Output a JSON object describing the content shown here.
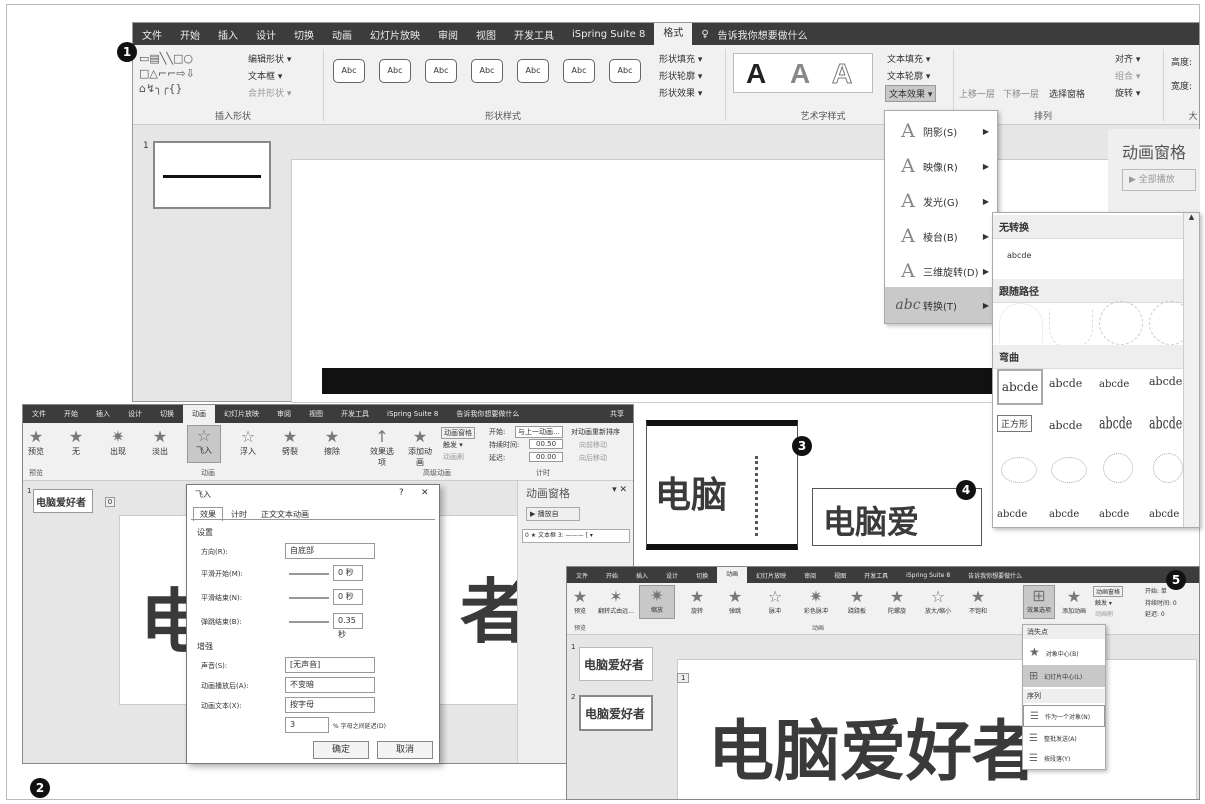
{
  "callouts": [
    "1",
    "2",
    "3",
    "4",
    "5"
  ],
  "win1": {
    "tabs": [
      "文件",
      "开始",
      "插入",
      "设计",
      "切换",
      "动画",
      "幻灯片放映",
      "审阅",
      "视图",
      "开发工具",
      "iSpring Suite 8",
      "格式"
    ],
    "active_tab": "格式",
    "tell_me": "告诉我你想要做什么",
    "insert_shapes_label": "插入形状",
    "edit_shape": "编辑形状 ▾",
    "text_box": "文本框 ▾",
    "merge_shapes": "合并形状 ▾",
    "shape_styles_label": "形状样式",
    "abc_label": "Abc",
    "shape_fill": "形状填充 ▾",
    "shape_outline": "形状轮廓 ▾",
    "shape_effects": "形状效果 ▾",
    "wordart_label": "艺术字样式",
    "wordart_letter": "A",
    "text_fill": "文本填充 ▾",
    "text_outline": "文本轮廓 ▾",
    "text_effects": "文本效果 ▾",
    "arrange_label": "排列",
    "bring_forward": "上移一层",
    "send_backward": "下移一层",
    "selection_pane": "选择窗格",
    "align": "对齐 ▾",
    "group": "组合 ▾",
    "rotate": "旋转 ▾",
    "height": "高度:",
    "width": "宽度:",
    "size_label": "大",
    "slide_num": "1",
    "anim_pane_title": "动画窗格",
    "play_all": "全部播放"
  },
  "effects_menu": [
    {
      "icon": "A",
      "label": "阴影(S)"
    },
    {
      "icon": "A",
      "label": "映像(R)"
    },
    {
      "icon": "A",
      "label": "发光(G)"
    },
    {
      "icon": "A",
      "label": "棱台(B)"
    },
    {
      "icon": "A",
      "label": "三维旋转(D)"
    },
    {
      "icon": "abc",
      "label": "转换(T)"
    }
  ],
  "transform_menu": {
    "no_transform": "无转换",
    "plain": "abcde",
    "follow_path": "跟随路径",
    "warp": "弯曲",
    "warp_row1": [
      "abcde",
      "abcde",
      "abcde",
      "abcde"
    ],
    "tooltip": "正方形",
    "warp_row2": [
      "abcde",
      "abcde",
      "abcde"
    ],
    "warp_row4": [
      "abcde",
      "abcde",
      "abcde",
      "abcde"
    ]
  },
  "win2": {
    "tabs": [
      "文件",
      "开始",
      "插入",
      "设计",
      "切换",
      "动画",
      "幻灯片放映",
      "审阅",
      "视图",
      "开发工具",
      "iSpring Suite 8"
    ],
    "active_tab": "动画",
    "tell_me": "告诉我你想要做什么",
    "share": "共享",
    "preview": "预览",
    "effects": [
      "无",
      "出现",
      "淡出",
      "飞入",
      "浮入",
      "劈裂",
      "擦除"
    ],
    "effect_options": "效果选项",
    "add_anim": "添加动画",
    "anim_pane_btn": "动画窗格",
    "trigger": "触发 ▾",
    "anim_painter": "动画刷",
    "start_lbl": "开始:",
    "start_val": "与上一动画...",
    "duration_lbl": "持续时间:",
    "duration_val": "00.50",
    "delay_lbl": "延迟:",
    "delay_val": "00.00",
    "reorder": "对动画重新排序",
    "move_earlier": "向前移动",
    "move_later": "向后移动",
    "group_preview": "预览",
    "group_anim": "动画",
    "group_adv": "高级动画",
    "group_timing": "计时",
    "slide_num": "1",
    "thumb_text": "电脑爱好者",
    "pane_title": "动画窗格",
    "play_from": "播放自",
    "pane_item": "0 ★ 文本框 3: ——— [ ▾",
    "big_left": "电",
    "big_right": "者",
    "anim_tag": "0"
  },
  "dialog": {
    "title": "飞入",
    "help": "?",
    "close": "✕",
    "tabs": [
      "效果",
      "计时",
      "正文文本动画"
    ],
    "settings": "设置",
    "direction_lbl": "方向(R):",
    "direction_val": "自底部",
    "smooth_start_lbl": "平滑开始(M):",
    "smooth_start_val": "0 秒",
    "smooth_end_lbl": "平滑结束(N):",
    "smooth_end_val": "0 秒",
    "bounce_end_lbl": "弹跳结束(B):",
    "bounce_end_val": "0.35 秒",
    "enhance": "增强",
    "sound_lbl": "声音(S):",
    "sound_val": "[无声音]",
    "after_lbl": "动画播放后(A):",
    "after_val": "不变暗",
    "anim_text_lbl": "动画文本(X):",
    "anim_text_val": "按字母",
    "delay_num": "3",
    "delay_suffix": "% 字母之间延迟(D)",
    "ok": "确定",
    "cancel": "取消"
  },
  "box3": {
    "text": "电脑"
  },
  "box4": {
    "text": "电脑爱"
  },
  "win5": {
    "tabs": [
      "文件",
      "开始",
      "插入",
      "设计",
      "切换",
      "动画",
      "幻灯片放映",
      "审阅",
      "视图",
      "开发工具",
      "iSpring Suite 8"
    ],
    "active_tab": "动画",
    "tell_me": "告诉我你想要做什么",
    "preview": "预览",
    "effects": [
      "翻转式由远...",
      "缩放",
      "旋转",
      "弹跳",
      "脉冲",
      "彩色脉冲",
      "跷跷板",
      "陀螺旋",
      "放大/缩小",
      "不饱和"
    ],
    "effect_options": "效果选项",
    "add_anim": "添加动画",
    "anim_pane_btn": "动画窗格",
    "trigger": "触发 ▾",
    "anim_painter": "动画刷",
    "start": "开始: 单",
    "duration": "持续时间: 0",
    "delay": "延迟: 0",
    "group_preview": "预览",
    "group_anim": "动画",
    "slides": [
      "1",
      "2"
    ],
    "thumb_text": "电脑爱好者",
    "anim_tag": "1",
    "big_text": "电脑爱好者",
    "menu_vanish": "消失点",
    "menu_obj_center": "对象中心(B)",
    "menu_slide_center": "幻灯片中心(L)",
    "menu_sequence": "序列",
    "menu_as_one": "作为一个对象(N)",
    "menu_all_at_once": "整批发送(A)",
    "menu_by_para": "按段落(Y)"
  }
}
